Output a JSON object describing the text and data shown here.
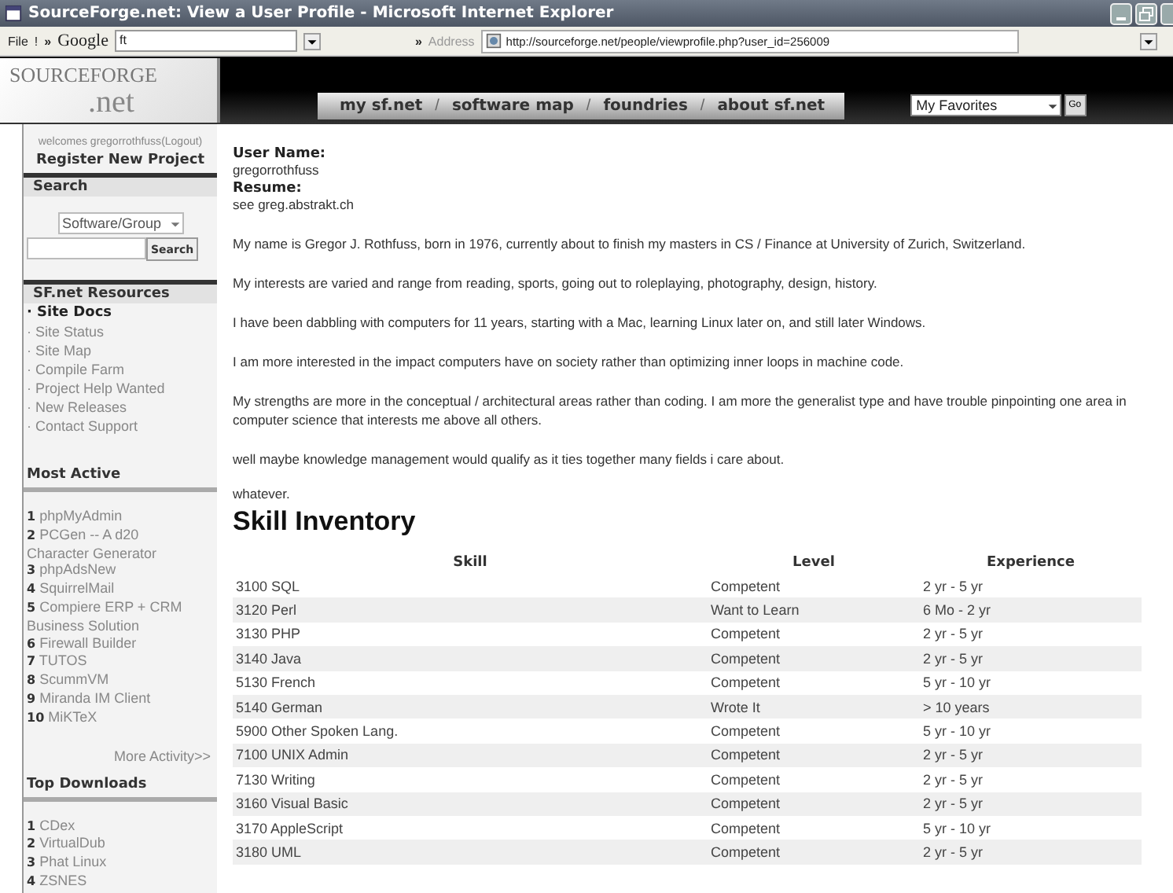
{
  "window": {
    "title": "SourceForge.net: View a User Profile - Microsoft Internet Explorer"
  },
  "toolbar": {
    "menu": "File",
    "links_button": "!",
    "chevron": "»",
    "google": "Google",
    "search_value": "ft",
    "chevron_2": "»",
    "address_label": "Address",
    "url": "http://sourceforge.net/people/viewprofile.php?user_id=256009"
  },
  "header": {
    "logo_top": "SOURCEFORGE",
    "logo_bottom": ".net",
    "tabs": [
      "my sf.net",
      "software map",
      "foundries",
      "about sf.net"
    ],
    "separator": "/",
    "favorites": "My Favorites",
    "go": "Go"
  },
  "sidebar": {
    "welcome": "welcomes gregorrothfuss",
    "logout": "(Logout)",
    "register": "Register New Project",
    "search": {
      "title": "Search",
      "select": "Software/Group",
      "button": "Search"
    },
    "resources": {
      "title": "SF.net Resources",
      "items": [
        {
          "label": "· Site Docs",
          "selected": true
        },
        {
          "label": "· Site Status",
          "selected": false
        },
        {
          "label": "· Site Map",
          "selected": false
        },
        {
          "label": "· Compile Farm",
          "selected": false
        },
        {
          "label": "· Project Help Wanted",
          "selected": false
        },
        {
          "label": "· New Releases",
          "selected": false
        },
        {
          "label": "· Contact Support",
          "selected": false
        }
      ]
    },
    "most_active": {
      "title": "Most Active",
      "items": [
        {
          "rank": "1",
          "name": "phpMyAdmin"
        },
        {
          "rank": "2",
          "name": "PCGen -- A d20 Character Generator"
        },
        {
          "rank": "3",
          "name": "phpAdsNew"
        },
        {
          "rank": "4",
          "name": "SquirrelMail"
        },
        {
          "rank": "5",
          "name": "Compiere ERP + CRM Business Solution"
        },
        {
          "rank": "6",
          "name": "Firewall Builder"
        },
        {
          "rank": "7",
          "name": "TUTOS"
        },
        {
          "rank": "8",
          "name": "ScummVM"
        },
        {
          "rank": "9",
          "name": "Miranda IM Client"
        },
        {
          "rank": "10",
          "name": "MiKTeX"
        }
      ],
      "more": "More Activity>>"
    },
    "top_downloads": {
      "title": "Top Downloads",
      "items": [
        {
          "rank": "1",
          "name": "CDex"
        },
        {
          "rank": "2",
          "name": "VirtualDub"
        },
        {
          "rank": "3",
          "name": "Phat Linux"
        },
        {
          "rank": "4",
          "name": "ZSNES"
        }
      ]
    }
  },
  "profile": {
    "fields": [
      {
        "label": "User Name:",
        "value": "gregorrothfuss"
      },
      {
        "label": "Resume:",
        "value": "see greg.abstrakt.ch"
      }
    ],
    "paragraphs": [
      "My name is Gregor J. Rothfuss, born in 1976, currently about to finish my masters in CS / Finance at University of Zurich, Switzerland.",
      "My interests are varied and range from reading, sports, going out to roleplaying, photography, design, history.",
      "I have been dabbling with computers for 11 years, starting with a Mac, learning Linux later on, and still later Windows.",
      "I am more interested in the impact computers have on society rather than optimizing inner loops in machine code.",
      "My strengths are more in the conceptual / architectural areas rather than coding. I am more the generalist type and have trouble pinpointing one area in computer science that interests me above all others.",
      "well maybe knowledge management would qualify as it ties together many fields i care about."
    ],
    "closing": "whatever."
  },
  "skills": {
    "title": "Skill Inventory",
    "columns": [
      "Skill",
      "Level",
      "Experience"
    ],
    "rows": [
      [
        "3100 SQL",
        "Competent",
        "2 yr - 5 yr"
      ],
      [
        "3120 Perl",
        "Want to Learn",
        "6 Mo - 2 yr"
      ],
      [
        "3130 PHP",
        "Competent",
        "2 yr - 5 yr"
      ],
      [
        "3140 Java",
        "Competent",
        "2 yr - 5 yr"
      ],
      [
        "5130 French",
        "Competent",
        "5 yr - 10 yr"
      ],
      [
        "5140 German",
        "Wrote It",
        "> 10 years"
      ],
      [
        "5900 Other Spoken Lang.",
        "Competent",
        "5 yr - 10 yr"
      ],
      [
        "7100 UNIX Admin",
        "Competent",
        "2 yr - 5 yr"
      ],
      [
        "7130 Writing",
        "Competent",
        "2 yr - 5 yr"
      ],
      [
        "3160 Visual Basic",
        "Competent",
        "2 yr - 5 yr"
      ],
      [
        "3170 AppleScript",
        "Competent",
        "5 yr - 10 yr"
      ],
      [
        "3180 UML",
        "Competent",
        "2 yr - 5 yr"
      ]
    ]
  }
}
